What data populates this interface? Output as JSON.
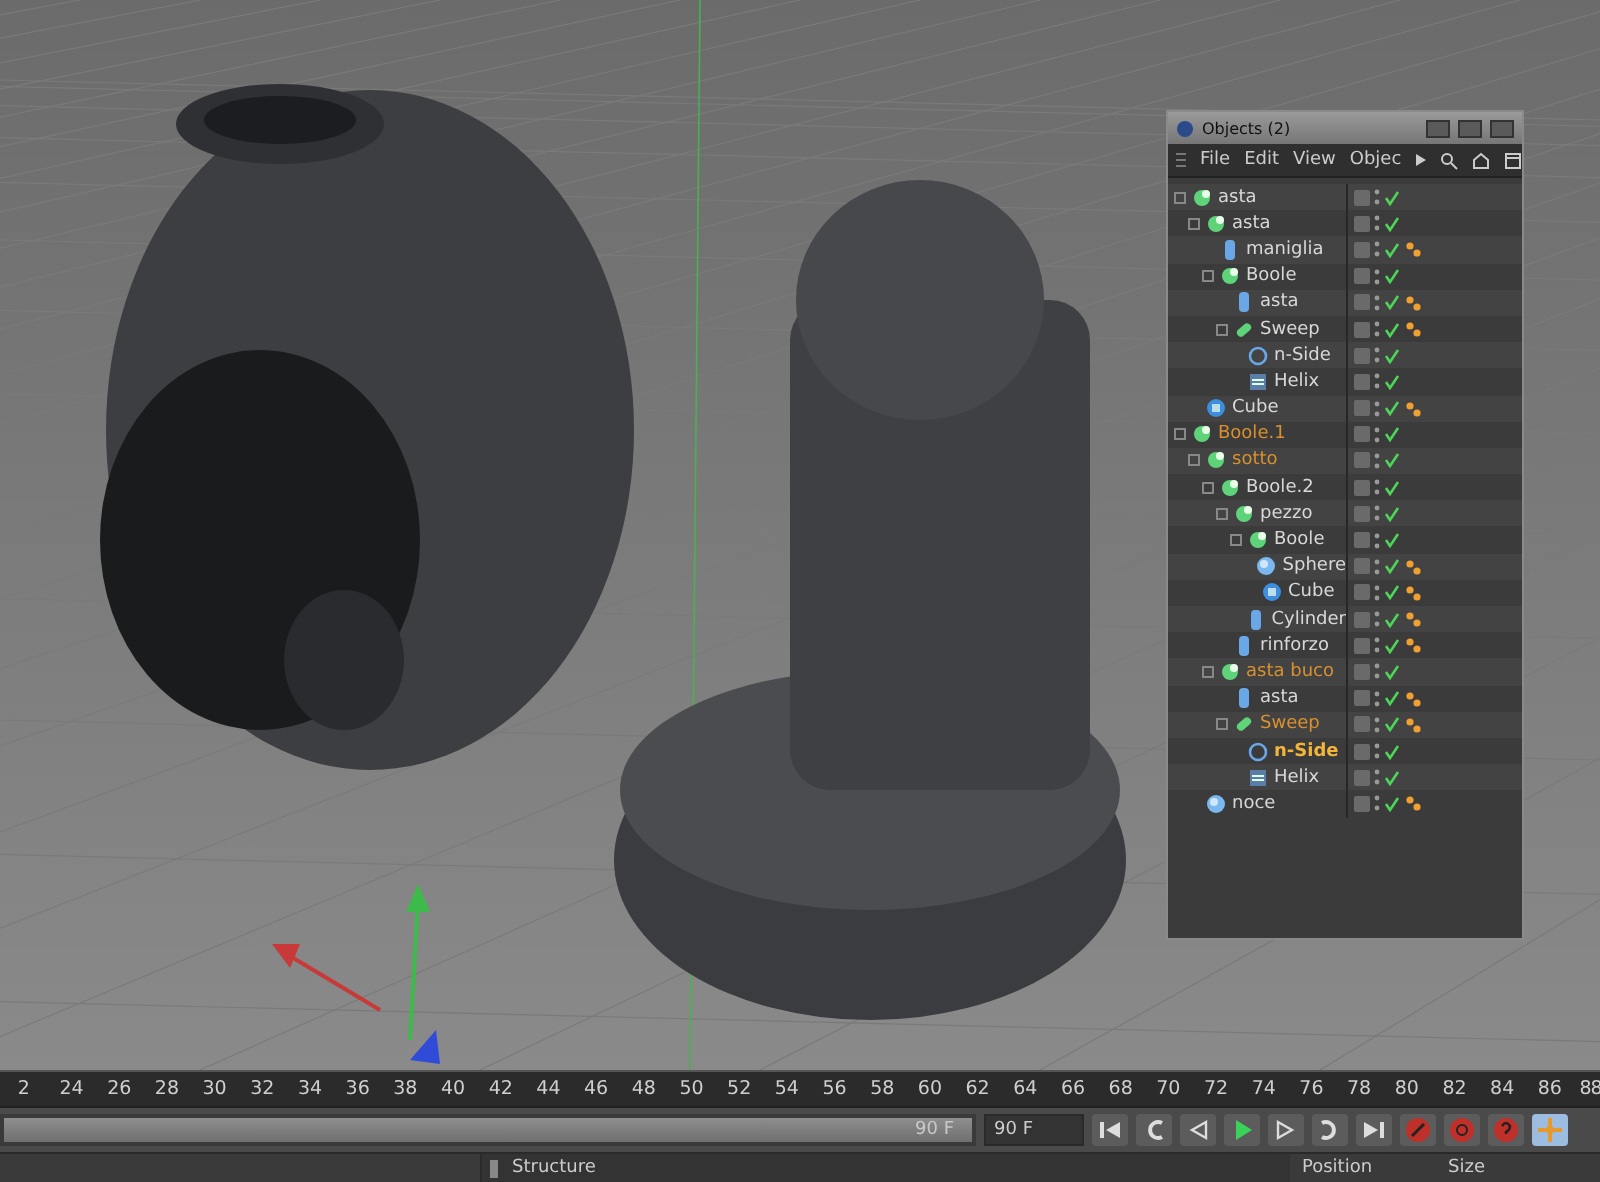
{
  "objects_window": {
    "title": "Objects (2)",
    "menu": [
      "File",
      "Edit",
      "View",
      "Objec"
    ],
    "tree": [
      {
        "label": "asta",
        "kind": "boole",
        "color": "#d8d8d8",
        "active": false,
        "tag": false,
        "children": [
          {
            "label": "asta",
            "kind": "boole",
            "color": "#d8d8d8",
            "active": false,
            "tag": false,
            "children": [
              {
                "label": "maniglia",
                "kind": "cylinder",
                "color": "#d8d8d8",
                "active": false,
                "tag": true
              },
              {
                "label": "Boole",
                "kind": "boole",
                "color": "#d8d8d8",
                "active": false,
                "tag": false,
                "children": [
                  {
                    "label": "asta",
                    "kind": "cylinder",
                    "color": "#d8d8d8",
                    "active": false,
                    "tag": true
                  },
                  {
                    "label": "Sweep",
                    "kind": "sweep",
                    "color": "#d8d8d8",
                    "active": false,
                    "tag": true,
                    "children": [
                      {
                        "label": "n-Side",
                        "kind": "spline",
                        "color": "#d8d8d8",
                        "active": false,
                        "tag": false
                      },
                      {
                        "label": "Helix",
                        "kind": "helix",
                        "color": "#d8d8d8",
                        "active": false,
                        "tag": false
                      }
                    ]
                  }
                ]
              }
            ]
          },
          {
            "label": "Cube",
            "kind": "cube",
            "color": "#d8d8d8",
            "active": false,
            "tag": true
          }
        ]
      },
      {
        "label": "Boole.1",
        "kind": "boole",
        "color": "#d9902e",
        "active": false,
        "tag": false,
        "children": [
          {
            "label": "sotto",
            "kind": "boole",
            "color": "#d9902e",
            "active": false,
            "tag": false,
            "children": [
              {
                "label": "Boole.2",
                "kind": "boole",
                "color": "#d8d8d8",
                "active": false,
                "tag": false,
                "children": [
                  {
                    "label": "pezzo",
                    "kind": "boole",
                    "color": "#d8d8d8",
                    "active": false,
                    "tag": false,
                    "children": [
                      {
                        "label": "Boole",
                        "kind": "boole",
                        "color": "#d8d8d8",
                        "active": false,
                        "tag": false,
                        "children": [
                          {
                            "label": "Sphere",
                            "kind": "sphere",
                            "color": "#d8d8d8",
                            "active": false,
                            "tag": true
                          },
                          {
                            "label": "Cube",
                            "kind": "cube",
                            "color": "#d8d8d8",
                            "active": false,
                            "tag": true
                          }
                        ]
                      },
                      {
                        "label": "Cylinder",
                        "kind": "cylinder",
                        "color": "#d8d8d8",
                        "active": false,
                        "tag": true
                      }
                    ]
                  },
                  {
                    "label": "rinforzo",
                    "kind": "cylinder",
                    "color": "#d8d8d8",
                    "active": false,
                    "tag": true
                  }
                ]
              },
              {
                "label": "asta buco",
                "kind": "boole",
                "color": "#d9902e",
                "active": false,
                "tag": false,
                "children": [
                  {
                    "label": "asta",
                    "kind": "cylinder",
                    "color": "#d8d8d8",
                    "active": false,
                    "tag": true
                  },
                  {
                    "label": "Sweep",
                    "kind": "sweep",
                    "color": "#d9902e",
                    "active": false,
                    "tag": true,
                    "children": [
                      {
                        "label": "n-Side",
                        "kind": "spline",
                        "color": "#f2b53a",
                        "active": true,
                        "tag": false
                      },
                      {
                        "label": "Helix",
                        "kind": "helix",
                        "color": "#d8d8d8",
                        "active": false,
                        "tag": false
                      }
                    ]
                  }
                ]
              }
            ]
          },
          {
            "label": "noce",
            "kind": "sphere",
            "color": "#d8d8d8",
            "active": false,
            "tag": true
          }
        ]
      }
    ]
  },
  "timeline": {
    "ticks": [
      "2",
      "24",
      "26",
      "28",
      "30",
      "32",
      "34",
      "36",
      "38",
      "40",
      "42",
      "44",
      "46",
      "48",
      "50",
      "52",
      "54",
      "56",
      "58",
      "60",
      "62",
      "64",
      "66",
      "68",
      "70",
      "72",
      "74",
      "76",
      "78",
      "80",
      "82",
      "84",
      "86",
      "88"
    ]
  },
  "playbar": {
    "range": {
      "label": "90 F",
      "level": 1
    },
    "end_field": {
      "value": "90 F"
    },
    "controls": [
      {
        "kind": "go-start"
      },
      {
        "kind": "key-back"
      },
      {
        "kind": "step-back"
      },
      {
        "kind": "play"
      },
      {
        "kind": "step-forward"
      },
      {
        "kind": "key-forward"
      },
      {
        "kind": "go-end"
      },
      {
        "kind": "record"
      },
      {
        "kind": "autokey"
      },
      {
        "kind": "keyhelp"
      },
      {
        "kind": "move"
      }
    ]
  },
  "bottom": {
    "structure_tab": "Structure",
    "columns": [
      "Position",
      "Size"
    ]
  }
}
